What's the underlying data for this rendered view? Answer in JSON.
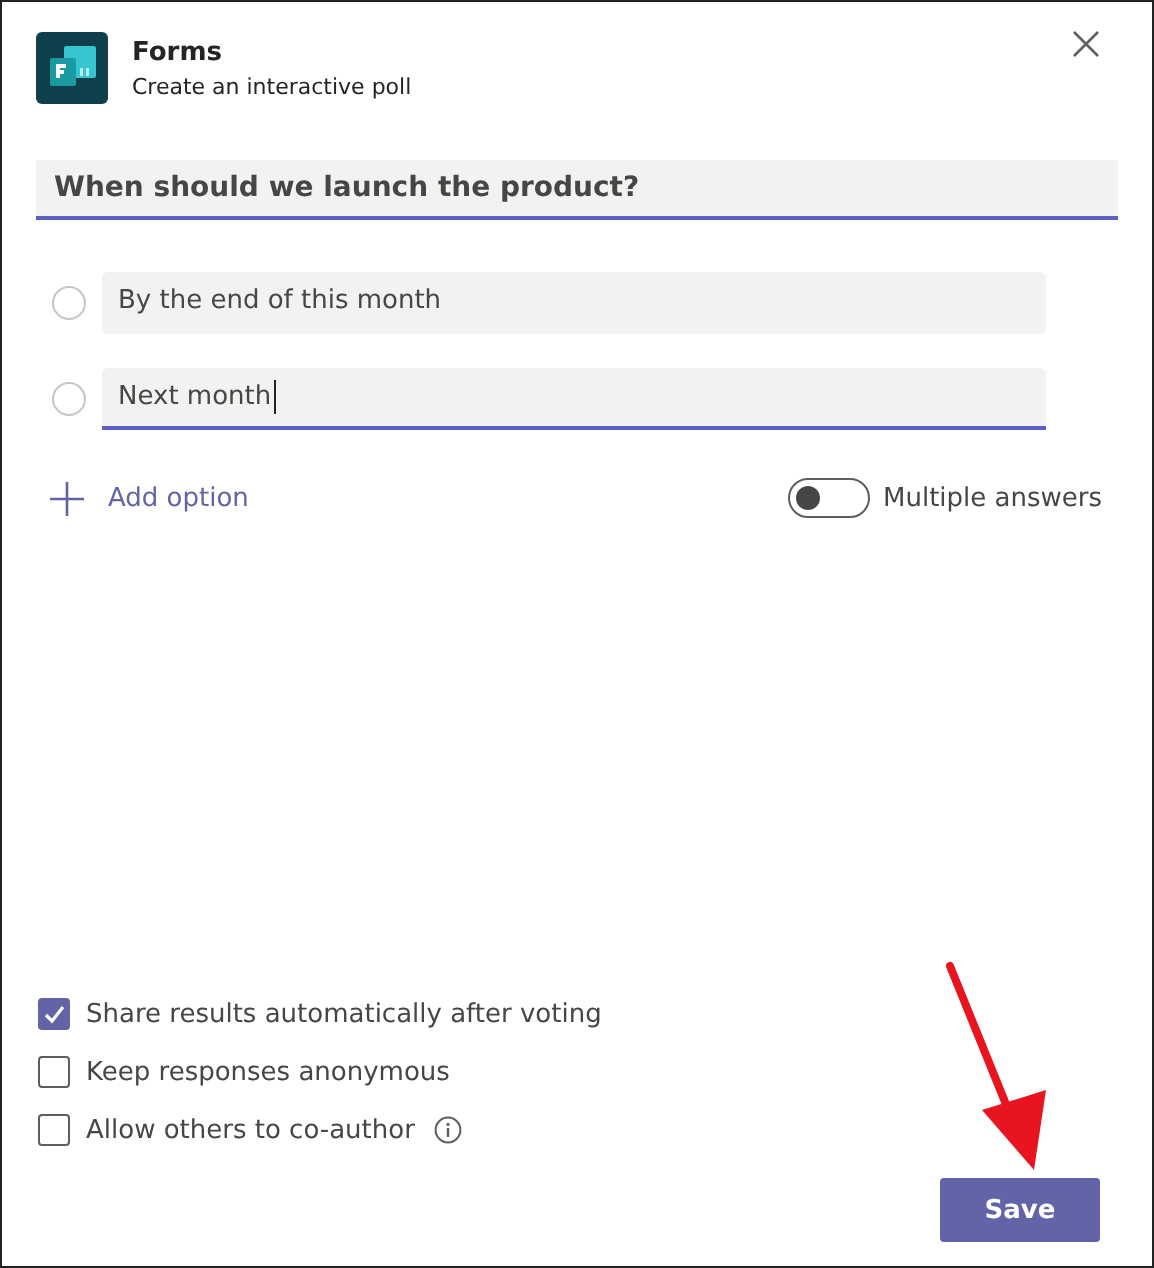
{
  "app": {
    "title": "Forms",
    "subtitle": "Create an interactive poll"
  },
  "question": {
    "value": "When should we launch the product?",
    "focused": true
  },
  "options": [
    {
      "value": "By the end of this month",
      "focused": false,
      "selected": false
    },
    {
      "value": "Next month",
      "focused": true,
      "selected": false
    }
  ],
  "add_option": "Add option",
  "multiple_answers": {
    "label": "Multiple answers",
    "on": false
  },
  "settings": [
    {
      "label": "Share results automatically after voting",
      "checked": true,
      "info": false
    },
    {
      "label": "Keep responses anonymous",
      "checked": false,
      "info": false
    },
    {
      "label": "Allow others to co-author",
      "checked": false,
      "info": true
    }
  ],
  "save": "Save"
}
